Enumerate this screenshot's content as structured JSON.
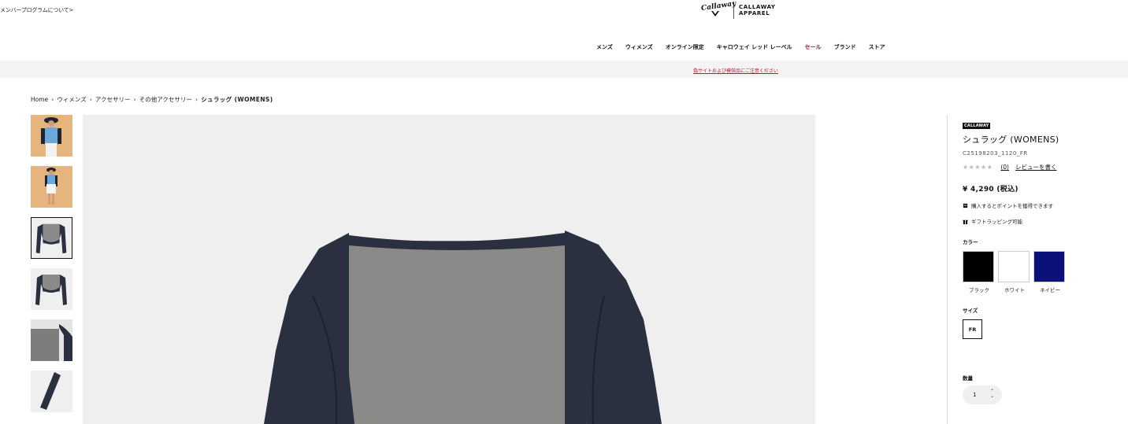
{
  "header": {
    "member_link": "メンバープログラムについて>",
    "logo_script": "Callaway",
    "logo_line1": "CALLAWAY",
    "logo_line2": "APPAREL"
  },
  "nav": {
    "items": [
      "メンズ",
      "ウィメンズ",
      "オンライン限定",
      "キャロウェイ レッド レーベル",
      "セール",
      "ブランド",
      "ストア"
    ]
  },
  "notice": {
    "text": "偽サイトおよび模倣品にご注意ください"
  },
  "breadcrumb": {
    "items": [
      "Home",
      "ウィメンズ",
      "アクセサリー",
      "その他アクセサリー"
    ],
    "current": "シュラッグ (WOMENS)"
  },
  "product": {
    "brand": "CALLAWAY",
    "title": "シュラッグ (WOMENS)",
    "code": "C25198203_1120_FR",
    "stars": "★★★★★",
    "rating_max": 5,
    "rating_value": 0,
    "review_count": "(0)",
    "review_link": "レビューを書く",
    "price": "¥ 4,290 (税込)",
    "feature_points": "購入するとポイントを獲得できます",
    "feature_gift": "ギフトラッピング可能",
    "color_label": "カラー",
    "colors": [
      {
        "name": "ブラック",
        "hex": "#000000"
      },
      {
        "name": "ホワイト",
        "hex": "#ffffff"
      },
      {
        "name": "ネイビー",
        "hex": "#0a0f7a"
      }
    ],
    "size_label": "サイズ",
    "size": "FR",
    "qty_label": "数量",
    "qty": "1"
  },
  "colors": {
    "sale": "#a1123a",
    "notice": "#c8102e",
    "garment_navy": "#2a3040",
    "garment_grey": "#8a8b88"
  }
}
